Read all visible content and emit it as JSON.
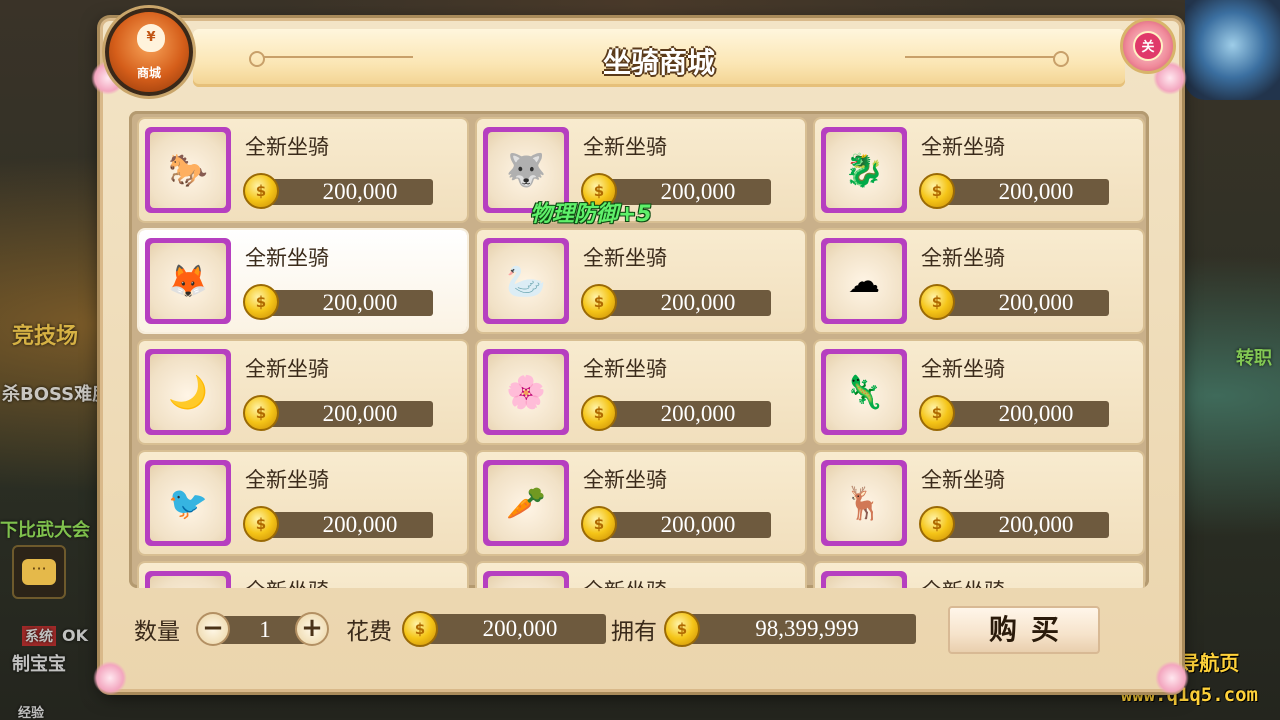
{
  "background": {
    "texts": [
      {
        "name": "bg-arena",
        "text": "竞技场"
      },
      {
        "name": "bg-boss",
        "text": "杀BOSS难度"
      },
      {
        "name": "bg-friends",
        "text": "下比武大会"
      },
      {
        "name": "bg-system",
        "text": "系统"
      },
      {
        "name": "bg-ok",
        "text": "OK"
      },
      {
        "name": "bg-treasure",
        "text": "制宝宝"
      },
      {
        "name": "bg-exp",
        "text": "经验"
      },
      {
        "name": "bg-right-job",
        "text": "转职"
      }
    ]
  },
  "watermark": {
    "line1": "踏月导航页",
    "line2": "www.q1q5.com"
  },
  "dialog": {
    "title": "坐骑商城",
    "shop_badge_label": "商城",
    "shop_badge_symbol": "¥",
    "close_label": "关",
    "floating_text": "物理防御+5",
    "items": [
      {
        "name": "全新坐骑",
        "price": "200,000",
        "icon": "🐎"
      },
      {
        "name": "全新坐骑",
        "price": "200,000",
        "icon": "🐺"
      },
      {
        "name": "全新坐骑",
        "price": "200,000",
        "icon": "🐉"
      },
      {
        "name": "全新坐骑",
        "price": "200,000",
        "icon": "🦊"
      },
      {
        "name": "全新坐骑",
        "price": "200,000",
        "icon": "🦢"
      },
      {
        "name": "全新坐骑",
        "price": "200,000",
        "icon": "☁"
      },
      {
        "name": "全新坐骑",
        "price": "200,000",
        "icon": "🌙"
      },
      {
        "name": "全新坐骑",
        "price": "200,000",
        "icon": "🌸"
      },
      {
        "name": "全新坐骑",
        "price": "200,000",
        "icon": "🦎"
      },
      {
        "name": "全新坐骑",
        "price": "200,000",
        "icon": "🐦"
      },
      {
        "name": "全新坐骑",
        "price": "200,000",
        "icon": "🥕"
      },
      {
        "name": "全新坐骑",
        "price": "200,000",
        "icon": "🦌"
      },
      {
        "name": "全新坐骑",
        "price": "",
        "icon": ""
      },
      {
        "name": "全新坐骑",
        "price": "",
        "icon": ""
      },
      {
        "name": "全新坐骑",
        "price": "",
        "icon": ""
      }
    ],
    "selected_index": 3,
    "coin_symbol": "$",
    "footer": {
      "quantity_label": "数量",
      "quantity_value": "1",
      "minus_label": "−",
      "plus_label": "+",
      "cost_label": "花费",
      "cost_value": "200,000",
      "own_label": "拥有",
      "own_value": "98,399,999",
      "buy_label": "购买"
    }
  },
  "colors": {
    "icon_frame": "#b63fc0",
    "price_bar": "#6e5a3e",
    "float_text": "#5ff06a",
    "title_outline": "#5a3a1a"
  }
}
